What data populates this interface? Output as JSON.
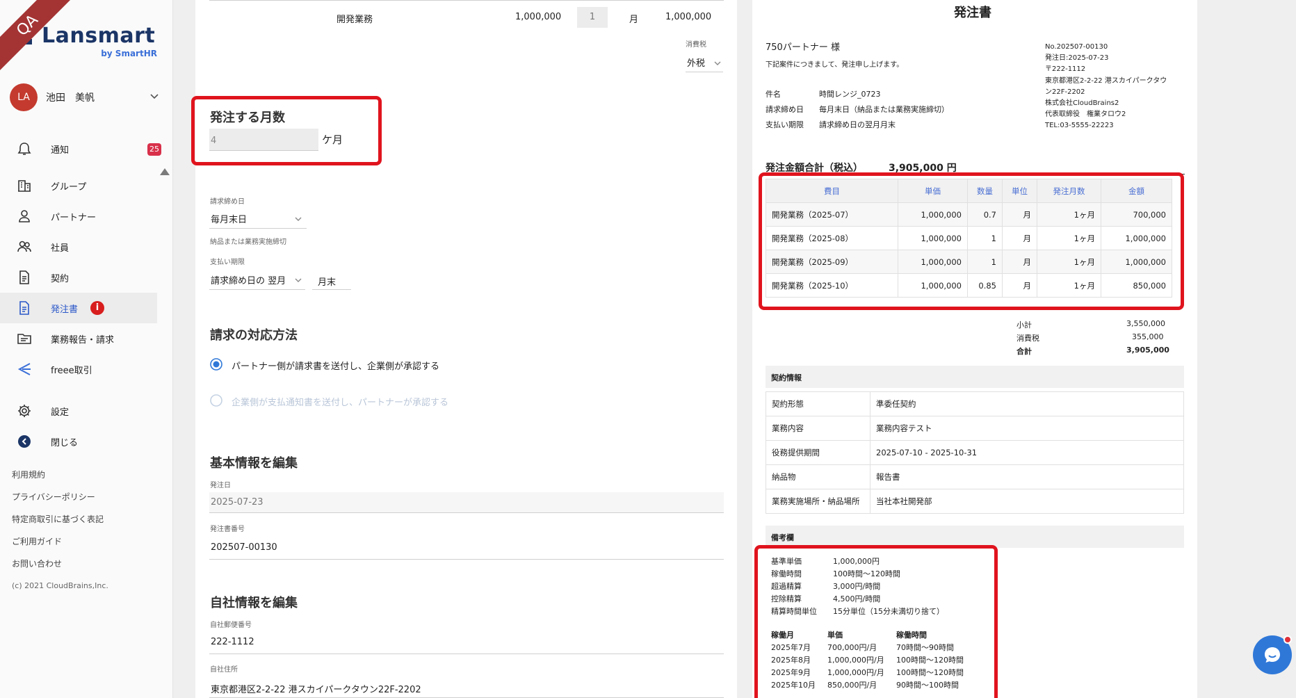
{
  "watermark": "QA",
  "brand": {
    "name": "Lansmart",
    "sub": "by SmartHR"
  },
  "user": {
    "initials": "LA",
    "name": "池田　美帆"
  },
  "nav": [
    {
      "label": "通知",
      "badge": "25",
      "icon": "bell-icon"
    },
    {
      "label": "グループ",
      "icon": "building-icon"
    },
    {
      "label": "パートナー",
      "icon": "person-icon"
    },
    {
      "label": "社員",
      "icon": "people-icon"
    },
    {
      "label": "契約",
      "icon": "document-icon"
    },
    {
      "label": "発注書",
      "badge": "i",
      "icon": "document-icon",
      "active": true
    },
    {
      "label": "業務報告・請求",
      "icon": "report-icon"
    },
    {
      "label": "freee取引",
      "icon": "freee-icon"
    },
    {
      "label": "設定",
      "icon": "gear-icon"
    },
    {
      "label": "閉じる",
      "icon": "close-sidebar-icon"
    }
  ],
  "footer_links": [
    "利用規約",
    "プライバシーポリシー",
    "特定商取引に基づく表記",
    "ご利用ガイド",
    "お問い合わせ"
  ],
  "copyright": "(c) 2021 CloudBrains,Inc.",
  "form": {
    "top_row": {
      "item": "開発業務",
      "price": "1,000,000",
      "qty": "1",
      "unit": "月",
      "amount": "1,000,000"
    },
    "tax": {
      "label": "消費税",
      "value": "外税"
    },
    "months": {
      "title": "発注する月数",
      "value": "4",
      "unit": "ケ月"
    },
    "billing_close": {
      "label": "請求締め日",
      "value": "毎月末日",
      "hint": "納品または業務実施締切"
    },
    "payment_due": {
      "label": "支払い期限",
      "value": "請求締め日の 翌月",
      "suffix": "月末"
    },
    "billing_method": {
      "title": "請求の対応方法",
      "options": [
        "パートナー側が請求書を送付し、企業側が承認する",
        "企業側が支払通知書を送付し、パートナーが承認する"
      ]
    },
    "basic": {
      "title": "基本情報を編集",
      "date_label": "発注日",
      "date_value": "2025-07-23",
      "number_label": "発注書番号",
      "number_value": "202507-00130"
    },
    "company": {
      "title": "自社情報を編集",
      "zip_label": "自社郵便番号",
      "zip_value": "222-1112",
      "addr_label": "自社住所",
      "addr_value": "東京都港区2-2-22 港スカイパークタウン22F-2202"
    }
  },
  "preview": {
    "title": "発注書",
    "to": "750パートナー 様",
    "intro": "下記案件につきまして、発注申し上げます。",
    "meta": [
      {
        "k": "件名",
        "v": "時間レンジ_0723"
      },
      {
        "k": "請求締め日",
        "v": "毎月末日（納品または業務実施締切）"
      },
      {
        "k": "支払い期限",
        "v": "請求締め日の翌月月末"
      }
    ],
    "issuer": [
      "No.202507-00130",
      "発注日:2025-07-23",
      "〒222-1112",
      "東京都港区2-2-22 港スカイパークタウ",
      "ン22F-2202",
      "株式会社CloudBrains2",
      "代表取締役　権業タロウ2",
      "TEL:03-5555-22223"
    ],
    "total_label": "発注金額合計（税込）",
    "total_value": "3,905,000 円",
    "table_headers": [
      "費目",
      "単価",
      "数量",
      "単位",
      "発注月数",
      "金額"
    ],
    "rows": [
      [
        "開発業務（2025-07）",
        "1,000,000",
        "0.7",
        "月",
        "1ヶ月",
        "700,000"
      ],
      [
        "開発業務（2025-08）",
        "1,000,000",
        "1",
        "月",
        "1ヶ月",
        "1,000,000"
      ],
      [
        "開発業務（2025-09）",
        "1,000,000",
        "1",
        "月",
        "1ヶ月",
        "1,000,000"
      ],
      [
        "開発業務（2025-10）",
        "1,000,000",
        "0.85",
        "月",
        "1ヶ月",
        "850,000"
      ]
    ],
    "summary": [
      {
        "k": "小計",
        "v": "3,550,000"
      },
      {
        "k": "消費税",
        "v": "355,000"
      },
      {
        "k": "合計",
        "v": "3,905,000"
      }
    ],
    "contract_title": "契約情報",
    "contract": [
      {
        "k": "契約形態",
        "v": "準委任契約"
      },
      {
        "k": "業務内容",
        "v": "業務内容テスト"
      },
      {
        "k": "役務提供期間",
        "v": "2025-07-10 - 2025-10-31"
      },
      {
        "k": "納品物",
        "v": "報告書"
      },
      {
        "k": "業務実施場所・納品場所",
        "v": "当社本社開発部"
      }
    ],
    "notes_title": "備考欄",
    "notes": [
      {
        "k": "基準単価",
        "v": "1,000,000円"
      },
      {
        "k": "稼働時間",
        "v": "100時間〜120時間"
      },
      {
        "k": "超過精算",
        "v": "3,000円/時間"
      },
      {
        "k": "控除精算",
        "v": "4,500円/時間"
      },
      {
        "k": "精算時間単位",
        "v": "15分単位（15分未満切り捨て）"
      }
    ],
    "rate_headers": [
      "稼働月",
      "単価",
      "稼働時間"
    ],
    "rates": [
      [
        "2025年7月",
        "700,000円/月",
        "70時間〜90時間"
      ],
      [
        "2025年8月",
        "1,000,000円/月",
        "100時間〜120時間"
      ],
      [
        "2025年9月",
        "1,000,000円/月",
        "100時間〜120時間"
      ],
      [
        "2025年10月",
        "850,000円/月",
        "90時間〜100時間"
      ]
    ]
  }
}
